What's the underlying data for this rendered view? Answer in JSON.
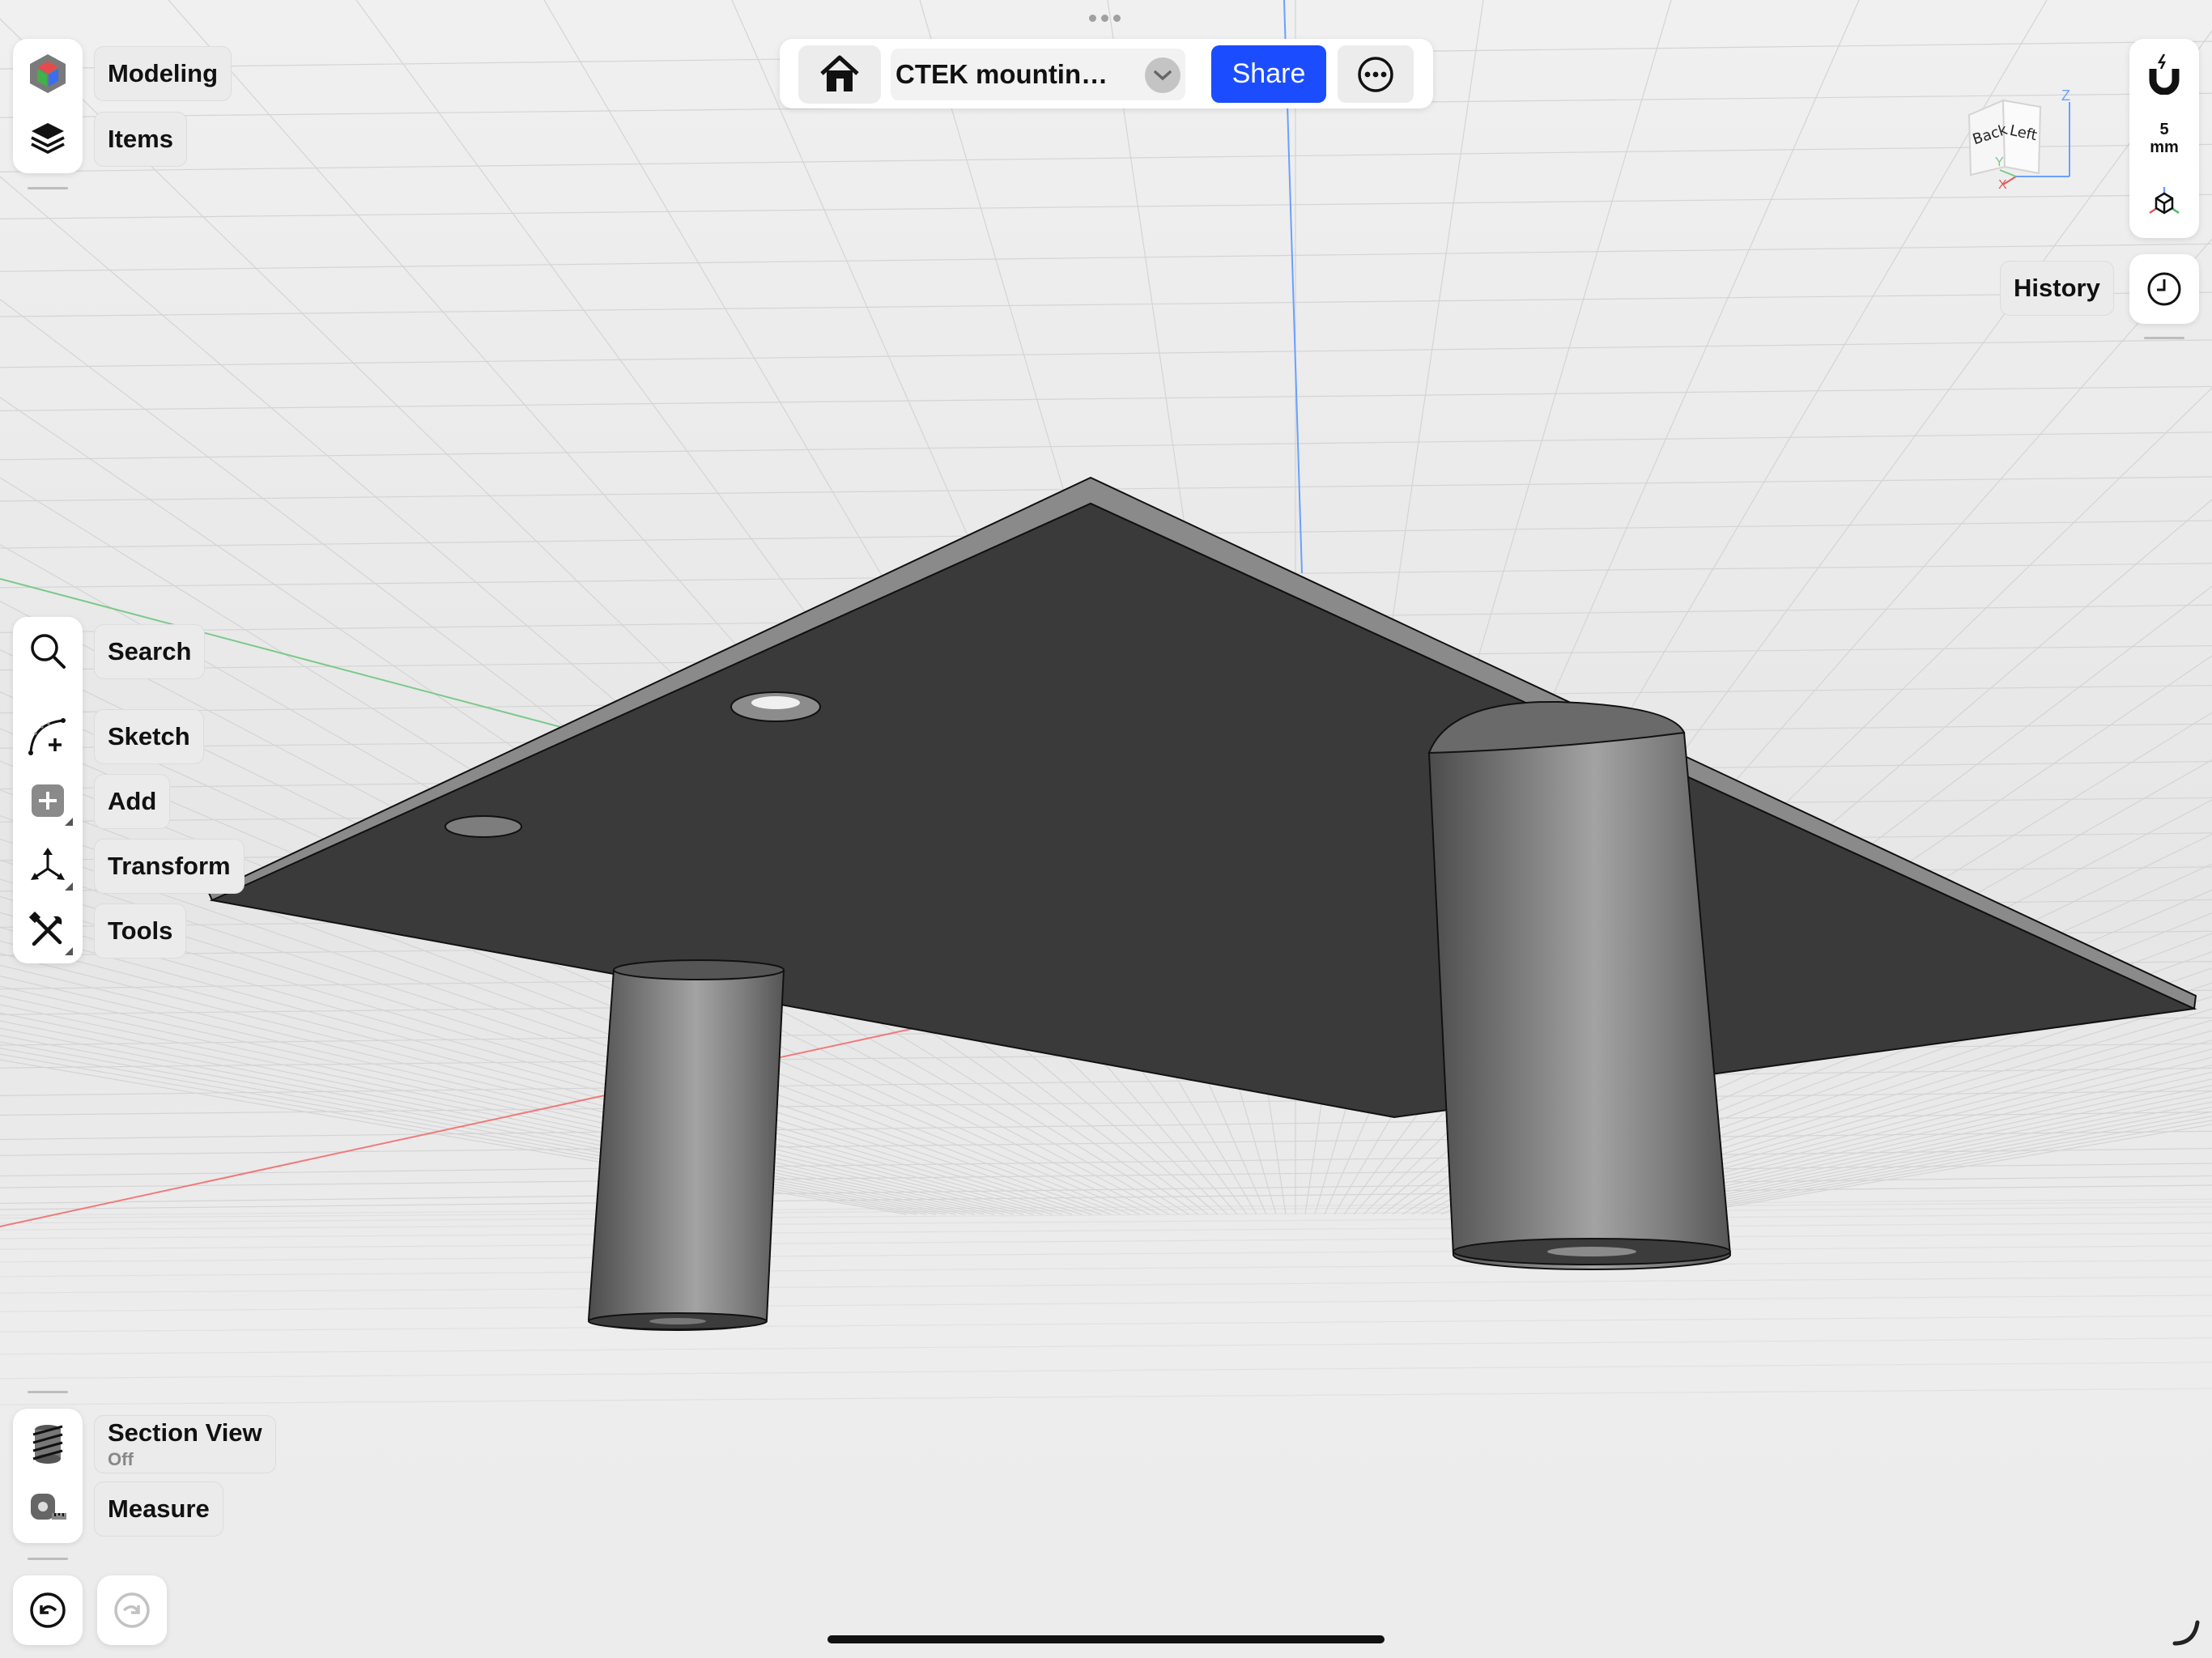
{
  "topbar": {
    "title": "CTEK mountin…",
    "share_label": "Share",
    "share_color": "#1b4dff",
    "icons": [
      "home-icon",
      "chevron-down-icon",
      "more-icon"
    ]
  },
  "left_top": {
    "items": [
      {
        "label": "Modeling",
        "icon": "modeling-cube-icon"
      },
      {
        "label": "Items",
        "icon": "layers-icon"
      }
    ]
  },
  "left_tools": {
    "items": [
      {
        "label": "Search",
        "icon": "search-icon"
      },
      {
        "label": "Sketch",
        "icon": "sketch-icon"
      },
      {
        "label": "Add",
        "icon": "plus-icon"
      },
      {
        "label": "Transform",
        "icon": "transform-icon"
      },
      {
        "label": "Tools",
        "icon": "tools-icon"
      }
    ]
  },
  "left_bottom": {
    "section_view_label": "Section View",
    "section_view_state": "Off",
    "measure_label": "Measure"
  },
  "right_panel": {
    "grid_size_value": "5",
    "grid_size_unit": "mm",
    "history_label": "History",
    "view_cube": {
      "face_back": "Back",
      "face_left": "Left",
      "axis_x": "X",
      "axis_y": "Y",
      "axis_z": "Z"
    }
  }
}
